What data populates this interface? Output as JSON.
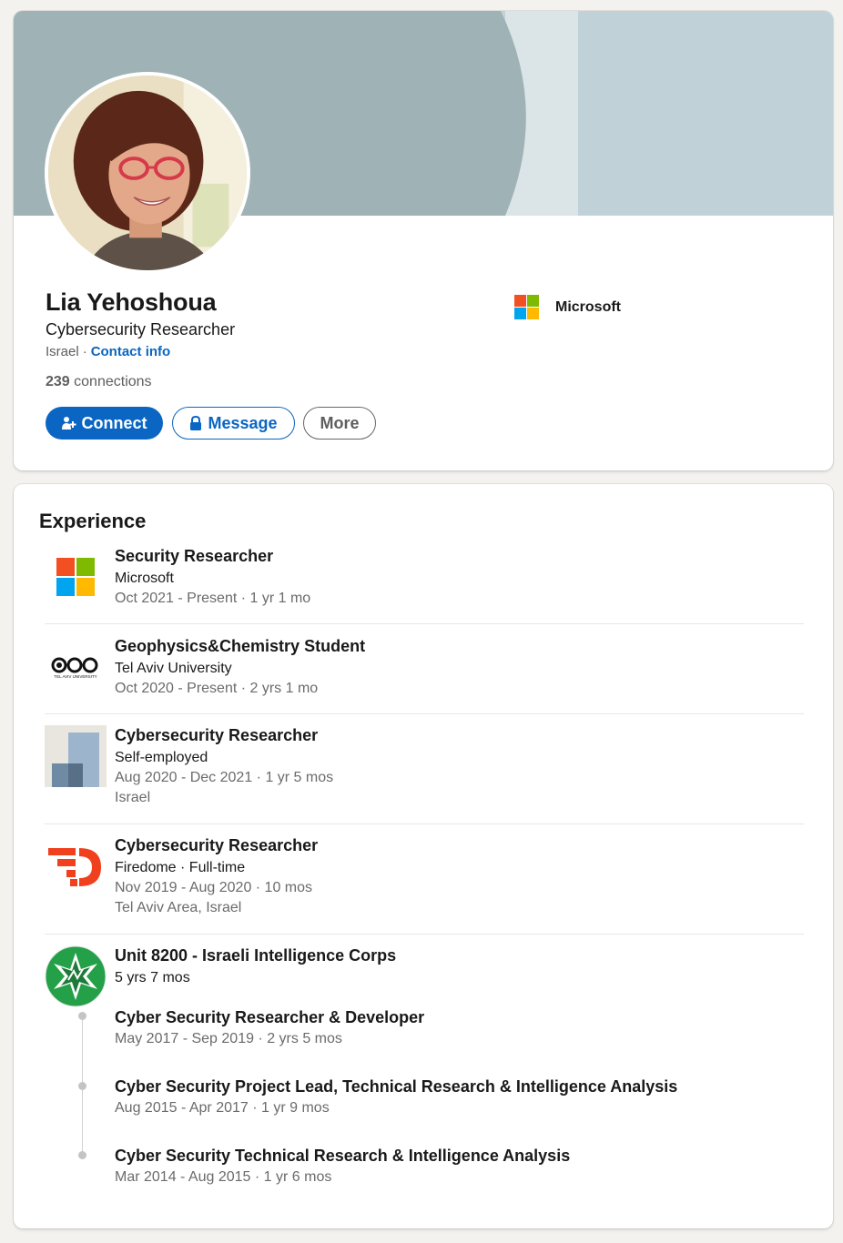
{
  "profile": {
    "name": "Lia Yehoshoua",
    "headline": "Cybersecurity Researcher",
    "location": "Israel",
    "separator": "·",
    "contact_info": "Contact info",
    "connections_count": "239",
    "connections_label": "connections",
    "current_company": "Microsoft",
    "buttons": {
      "connect": "Connect",
      "message": "Message",
      "more": "More"
    }
  },
  "experience": {
    "title": "Experience",
    "items": [
      {
        "title": "Security Researcher",
        "company": "Microsoft",
        "dates": "Oct 2021 - Present · 1 yr 1 mo",
        "logo": "microsoft-logo"
      },
      {
        "title": "Geophysics&Chemistry Student",
        "company": "Tel Aviv University",
        "dates": "Oct 2020 - Present · 2 yrs 1 mo",
        "logo": "tel-aviv-university-logo",
        "logo_text": "TEL AVIV UNIVERSITY"
      },
      {
        "title": "Cybersecurity Researcher",
        "company": "Self-employed",
        "dates": "Aug 2020 - Dec 2021 · 1 yr 5 mos",
        "location": "Israel",
        "logo": "generic-company-logo"
      },
      {
        "title": "Cybersecurity Researcher",
        "company": "Firedome · Full-time",
        "dates": "Nov 2019 - Aug 2020 · 10 mos",
        "location": "Tel Aviv Area, Israel",
        "logo": "firedome-logo"
      },
      {
        "title": "Unit 8200 - Israeli Intelligence Corps",
        "duration": "5 yrs 7 mos",
        "logo": "unit-8200-logo",
        "roles": [
          {
            "title": "Cyber Security Researcher & Developer",
            "dates": "May 2017 - Sep 2019 · 2 yrs 5 mos"
          },
          {
            "title": "Cyber Security Project Lead, Technical Research & Intelligence Analysis",
            "dates": "Aug 2015 - Apr 2017 · 1 yr 9 mos"
          },
          {
            "title": "Cyber Security Technical Research & Intelligence Analysis",
            "dates": "Mar 2014 - Aug 2015 · 1 yr 6 mos"
          }
        ]
      }
    ]
  },
  "colors": {
    "primary": "#0a66c2",
    "banner_dark": "#9fb2b6",
    "banner_mid": "#dbe4e6",
    "banner_light": "#c0d2d8",
    "ms_red": "#f25022",
    "ms_green": "#7fba00",
    "ms_blue": "#00a4ef",
    "ms_yellow": "#ffb900",
    "firedome_red": "#f0401e",
    "unit8200_green": "#23a048"
  }
}
